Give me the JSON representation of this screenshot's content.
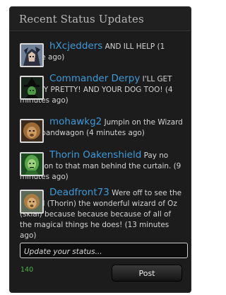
{
  "widget": {
    "title": "Recent Status Updates"
  },
  "statuses": [
    {
      "user": "hXcjedders",
      "message": "AND ILL HELP",
      "time": "(1 minute ago)",
      "avatar": "anime-character-avatar"
    },
    {
      "user": "Commander Derpy",
      "message": "I'LL GET YOU MY PRETTY! AND YOUR DOG TOO!",
      "time": "(4 minutes ago)",
      "avatar": "witch-avatar"
    },
    {
      "user": "mohawkg2",
      "message": "Jumpin on the Wizard of Oz bandwagon",
      "time": "(4 minutes ago)",
      "avatar": "cowardly-lion-avatar"
    },
    {
      "user": "Thorin Oakenshield",
      "message": "Pay no attention to that man behind the curtain.",
      "time": "(9 minutes ago)",
      "avatar": "wizard-of-oz-avatar"
    },
    {
      "user": "Deadfront73",
      "message": "Were off to see the Wizard (Thorin) the wonderful wizard of Oz (skial) because because because of all of the magical things he does!",
      "time": "(13 minutes ago)",
      "avatar": "lion-avatar"
    }
  ],
  "composer": {
    "placeholder": "Update your status...",
    "value": "",
    "char_count": "140",
    "post_label": "Post"
  },
  "colors": {
    "background": "#1c1c1c",
    "username": "#3e9ad8",
    "text": "#d4d4d4",
    "counter": "#4bb34b"
  }
}
